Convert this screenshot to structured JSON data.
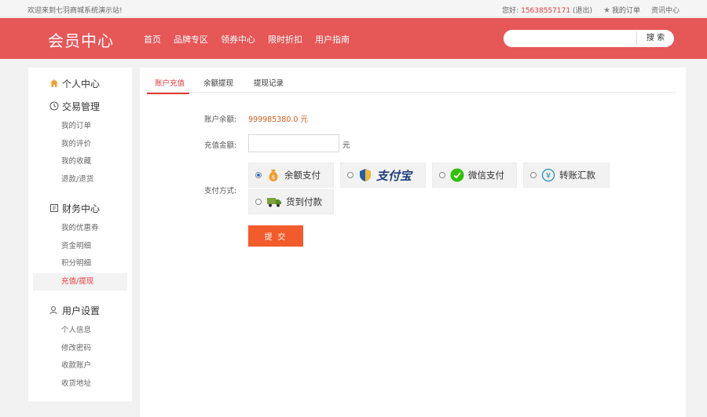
{
  "topbar": {
    "welcome": "欢迎来到七羽商城系统演示站!",
    "greeting": "您好:",
    "phone": "15638557171",
    "logout": "(退出)",
    "my_orders": "我的订单",
    "news": "资讯中心"
  },
  "header": {
    "logo": "会员中心",
    "nav": [
      "首页",
      "品牌专区",
      "领券中心",
      "限时折扣",
      "用户指南"
    ],
    "search_placeholder": "",
    "search_button": "搜 索"
  },
  "sidebar": {
    "personal_center": "个人中心",
    "trade": {
      "title": "交易管理",
      "items": [
        "我的订单",
        "我的评价",
        "我的收藏",
        "退款/退货"
      ]
    },
    "finance": {
      "title": "财务中心",
      "items": [
        "我的优惠券",
        "资金明细",
        "积分明细",
        "充值/提现"
      ]
    },
    "user": {
      "title": "用户设置",
      "items": [
        "个人信息",
        "修改密码",
        "收款账户",
        "收货地址"
      ]
    }
  },
  "main": {
    "tabs": [
      "账户充值",
      "余额提现",
      "提现记录"
    ],
    "balance_label": "账户余额:",
    "balance_value": "999985380.0 元",
    "amount_label": "充值金额:",
    "amount_value": "",
    "amount_unit": "元",
    "pay_label": "支付方式:",
    "pay_methods": [
      "余额支付",
      "支付宝",
      "微信支付",
      "转账汇款",
      "货到付款"
    ],
    "selected_method": "余额支付",
    "submit": "提 交"
  },
  "colors": {
    "brand": "#e65757",
    "accent": "#e4393c",
    "submit": "#f25b2b"
  }
}
